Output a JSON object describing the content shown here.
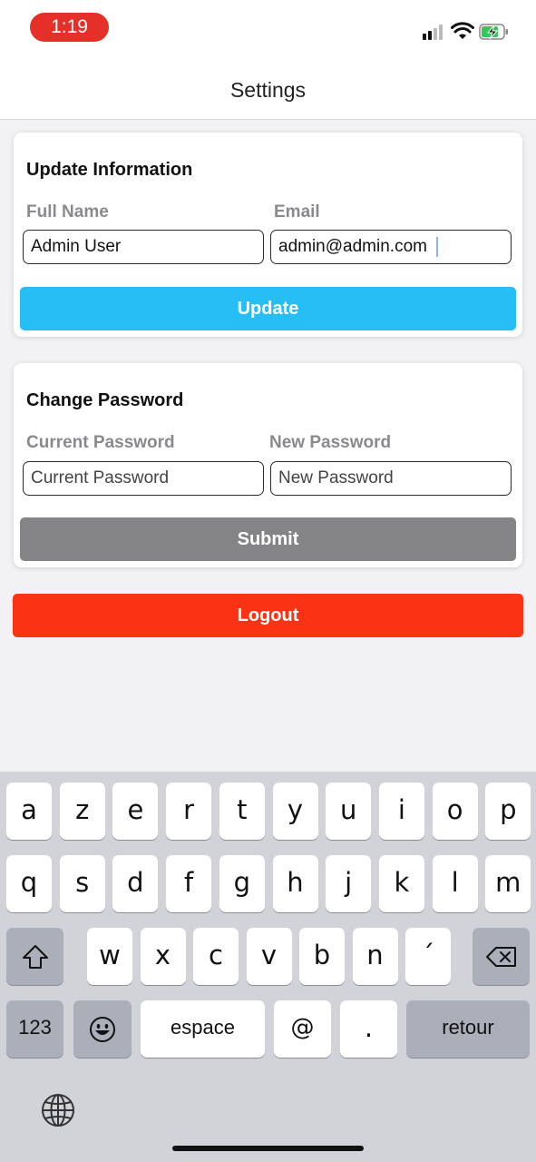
{
  "status_bar": {
    "time": "1:19"
  },
  "nav": {
    "title": "Settings"
  },
  "update_card": {
    "title": "Update Information",
    "full_name_label": "Full Name",
    "full_name_value": "Admin User",
    "email_label": "Email",
    "email_value": "admin@admin.com",
    "button_label": "Update",
    "button_color": "#27bef5"
  },
  "password_card": {
    "title": "Change Password",
    "current_label": "Current Password",
    "current_placeholder": "Current Password",
    "new_label": "New Password",
    "new_placeholder": "New Password",
    "button_label": "Submit",
    "button_color": "#848487"
  },
  "logout": {
    "label": "Logout",
    "color": "#fa3314"
  },
  "keyboard": {
    "row1": [
      "a",
      "z",
      "e",
      "r",
      "t",
      "y",
      "u",
      "i",
      "o",
      "p"
    ],
    "row2": [
      "q",
      "s",
      "d",
      "f",
      "g",
      "h",
      "j",
      "k",
      "l",
      "m"
    ],
    "row3": [
      "w",
      "x",
      "c",
      "v",
      "b",
      "n",
      "´"
    ],
    "numbers_label": "123",
    "space_label": "espace",
    "at_label": "@",
    "period_label": ".",
    "return_label": "retour",
    "icons": [
      "shift-icon",
      "backspace-icon",
      "emoji-icon",
      "globe-icon"
    ]
  }
}
